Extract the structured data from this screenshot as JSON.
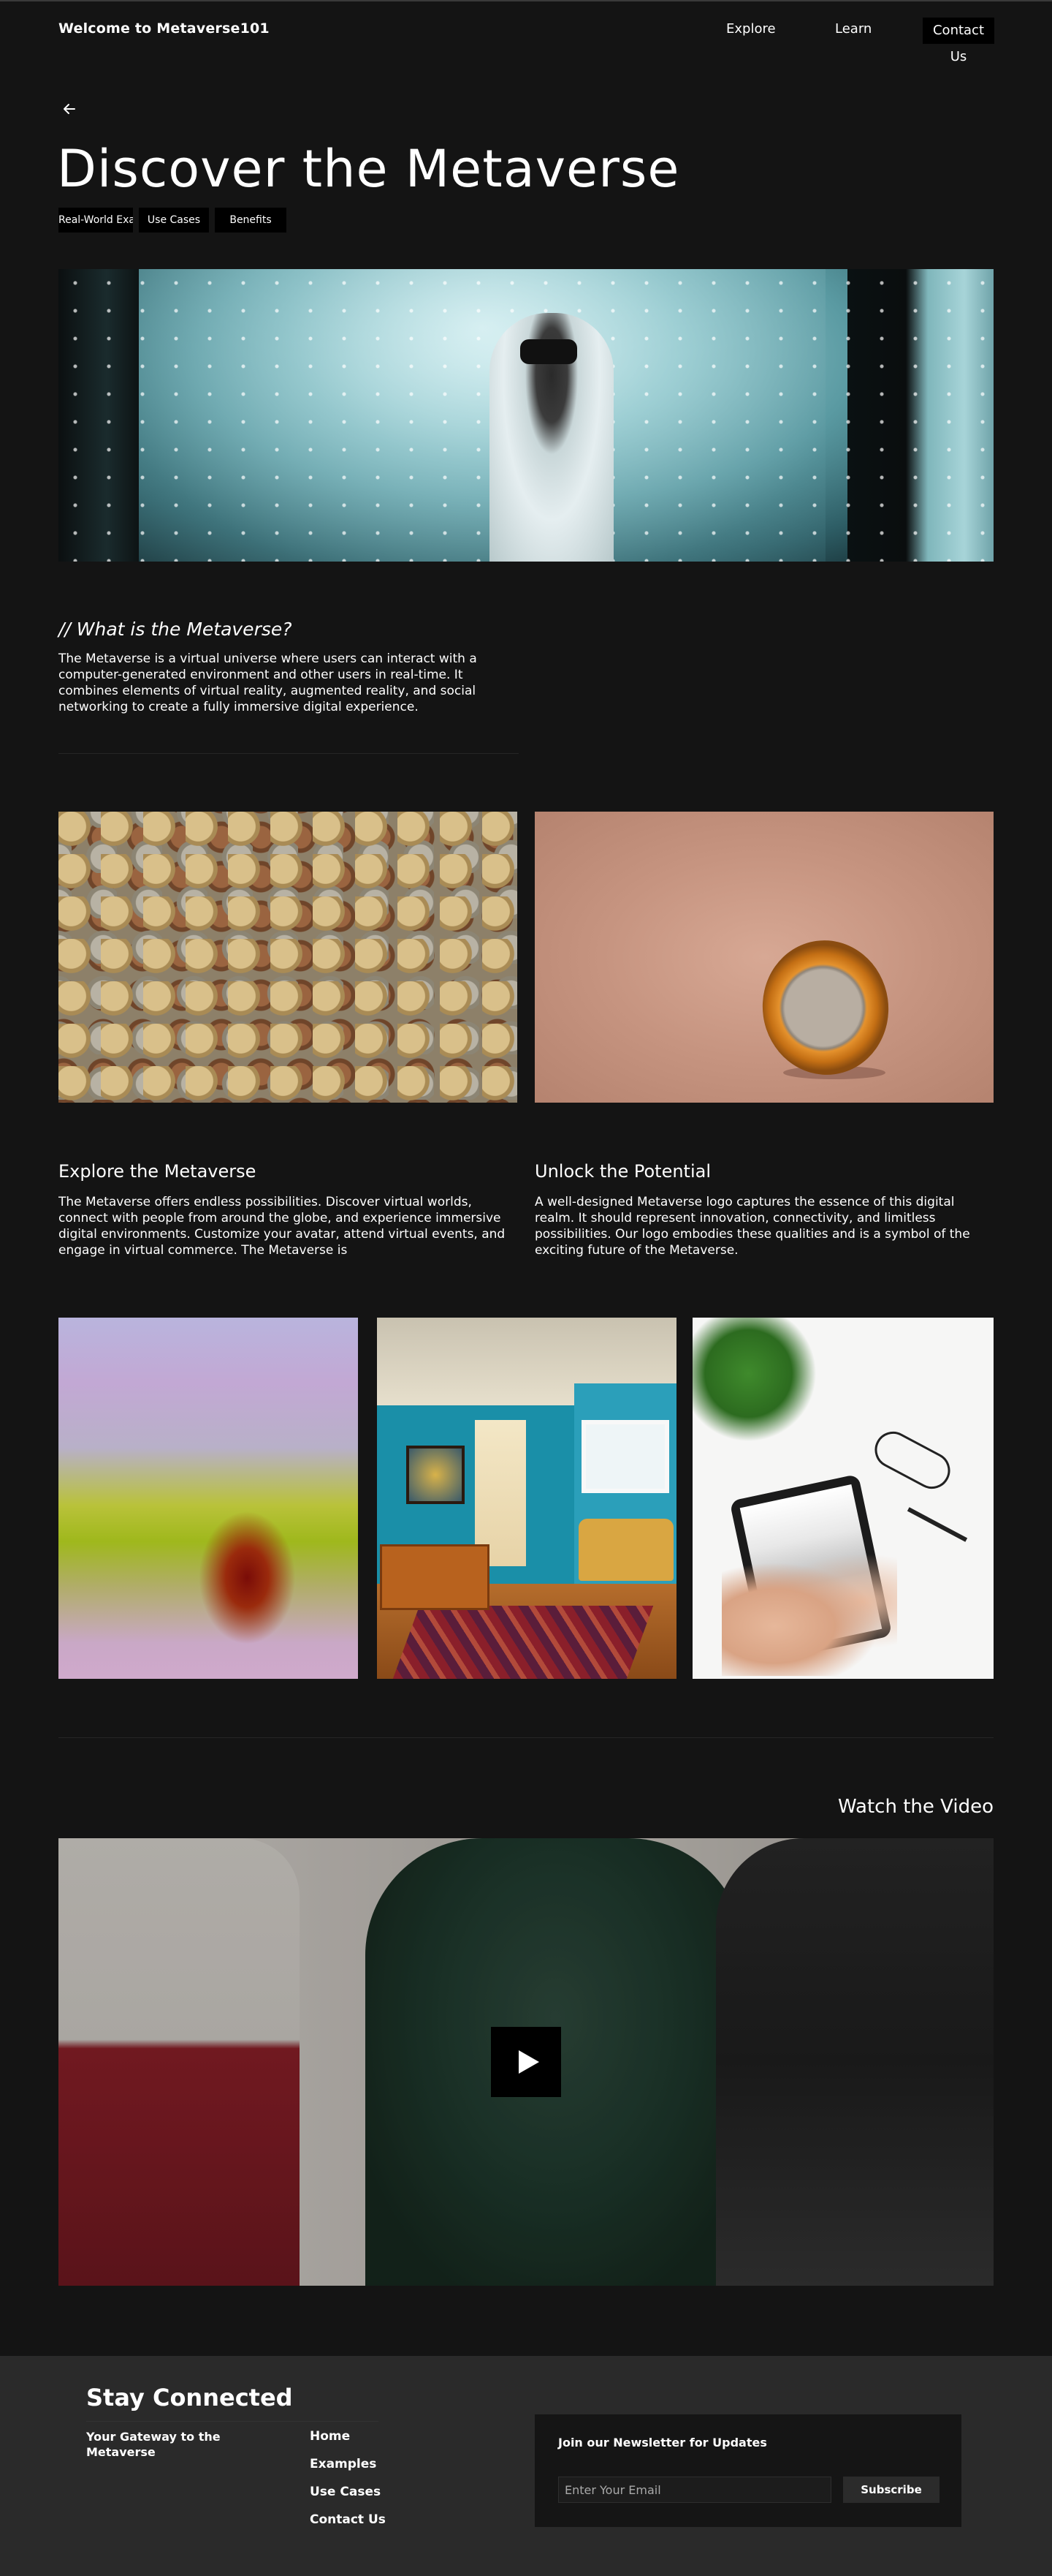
{
  "header": {
    "brand": "Welcome to Metaverse101",
    "nav": [
      "Explore",
      "Learn",
      "Contact Us"
    ]
  },
  "page": {
    "title": "Discover the Metaverse",
    "chips": [
      "Real-World Examples",
      "Use Cases",
      "Benefits"
    ]
  },
  "intro": {
    "heading": "// What is the Metaverse?",
    "body": "The Metaverse is a virtual universe where users can interact with a computer-generated environment and other users in real-time. It combines elements of virtual reality, augmented reality, and social networking to create a fully immersive digital experience."
  },
  "cards": [
    {
      "title": "Explore the Metaverse",
      "body": "The Metaverse offers endless possibilities. Discover virtual worlds, connect with people from around the globe, and experience immersive digital environments. Customize your avatar, attend virtual events, and engage in virtual commerce. The Metaverse is"
    },
    {
      "title": "Unlock the Potential",
      "body": "A well-designed Metaverse logo captures the essence of this digital realm. It should represent innovation, connectivity, and limitless possibilities. Our logo embodies these qualities and is a symbol of the exciting future of the Metaverse."
    }
  ],
  "video": {
    "title": "Watch the Video",
    "play_icon": "play-icon"
  },
  "footer": {
    "title": "Stay Connected",
    "tagline": "Your Gateway to the Metaverse",
    "links": [
      "Home",
      "Examples",
      "Use Cases",
      "Contact Us"
    ],
    "newsletter": {
      "title": "Join our Newsletter for Updates",
      "placeholder": "Enter Your Email",
      "button": "Subscribe"
    }
  },
  "icons": {
    "back": "arrow-left-icon"
  },
  "colors": {
    "background": "#141414",
    "footer": "#2a2a2a",
    "chip": "#000000"
  }
}
